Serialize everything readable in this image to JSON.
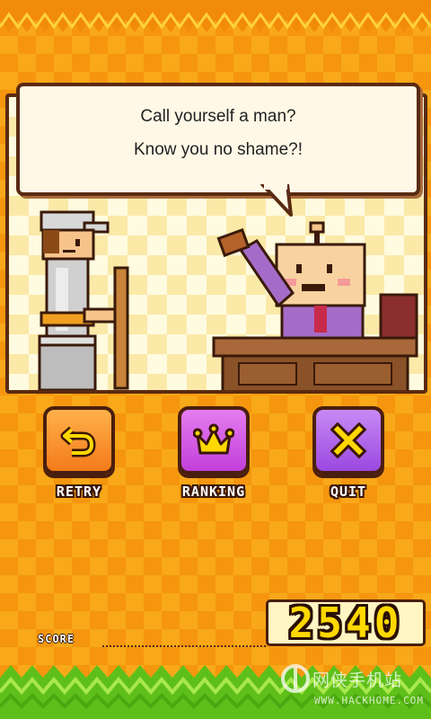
{
  "dialogue": {
    "line1": "Call yourself a man?",
    "line2": "Know you no shame?!"
  },
  "buttons": {
    "retry": {
      "label": "RETRY",
      "icon": "undo-arrow-icon",
      "color": "#f47a1a"
    },
    "ranking": {
      "label": "RANKING",
      "icon": "crown-icon",
      "color": "#c23fd9"
    },
    "quit": {
      "label": "QUIT",
      "icon": "x-icon",
      "color": "#9b48e0"
    }
  },
  "score": {
    "label": "SCORE",
    "value": "2540"
  },
  "watermark": {
    "text": "网侠手机站",
    "url": "WWW.HACKHOME.COM"
  },
  "colors": {
    "background": "#f8a818",
    "border": "#5a2a12",
    "score_digits": "#ffd800",
    "grass": "#7ed321"
  }
}
